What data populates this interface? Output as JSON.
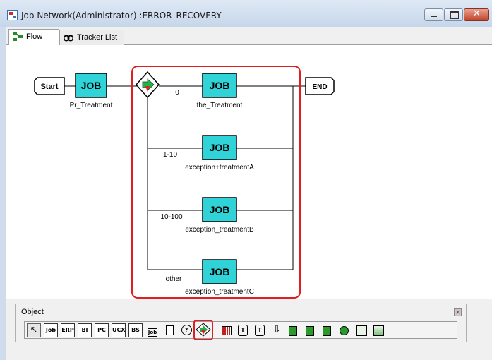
{
  "window": {
    "title": "Job Network(Administrator) :ERROR_RECOVERY",
    "buttons": {
      "minimize": "–",
      "maximize": "□",
      "close": "✕"
    }
  },
  "tabs": [
    {
      "label": "Flow",
      "icon": "flow-icon",
      "active": true
    },
    {
      "label": "Tracker List",
      "icon": "tracker-icon",
      "active": false
    }
  ],
  "flow": {
    "start_label": "Start",
    "end_label": "END",
    "job_text": "JOB",
    "jobs": [
      {
        "name": "Pr_Treatment"
      },
      {
        "name": "the_Treatment"
      },
      {
        "name": "exception+treatmentA"
      },
      {
        "name": "exception_treatmentB"
      },
      {
        "name": "exception_treatmentC"
      }
    ],
    "branches": [
      {
        "condition": "0"
      },
      {
        "condition": "1-10"
      },
      {
        "condition": "10-100"
      },
      {
        "condition": "other"
      }
    ],
    "highlight_color": "#e02020",
    "job_color": "#2fd3d8"
  },
  "object_panel": {
    "title": "Object",
    "tools": [
      {
        "name": "pointer-tool",
        "label": "↖"
      },
      {
        "name": "job-tool",
        "label": "Job"
      },
      {
        "name": "erp-tool",
        "label": "ERP"
      },
      {
        "name": "bi-tool",
        "label": "BI"
      },
      {
        "name": "pc-tool",
        "label": "PC"
      },
      {
        "name": "ucx-tool",
        "label": "UCX"
      },
      {
        "name": "bs-tool",
        "label": "BS"
      },
      {
        "name": "job-group-tool",
        "label": "Job"
      },
      {
        "name": "dialog-tool",
        "label": ""
      },
      {
        "name": "question-tool",
        "label": "?"
      },
      {
        "name": "branch-tool",
        "label": ""
      },
      {
        "name": "calendar-tool",
        "label": ""
      },
      {
        "name": "tbar-tool",
        "label": "T"
      },
      {
        "name": "tbar-r-tool",
        "label": "T"
      },
      {
        "name": "down-arrow-tool",
        "label": "⇩"
      },
      {
        "name": "job-send-tool",
        "label": ""
      },
      {
        "name": "job-receive-tool",
        "label": ""
      },
      {
        "name": "job-file-tool",
        "label": ""
      },
      {
        "name": "job-wait-tool",
        "label": ""
      },
      {
        "name": "job-edit-tool",
        "label": ""
      },
      {
        "name": "job-image-tool",
        "label": ""
      }
    ]
  }
}
